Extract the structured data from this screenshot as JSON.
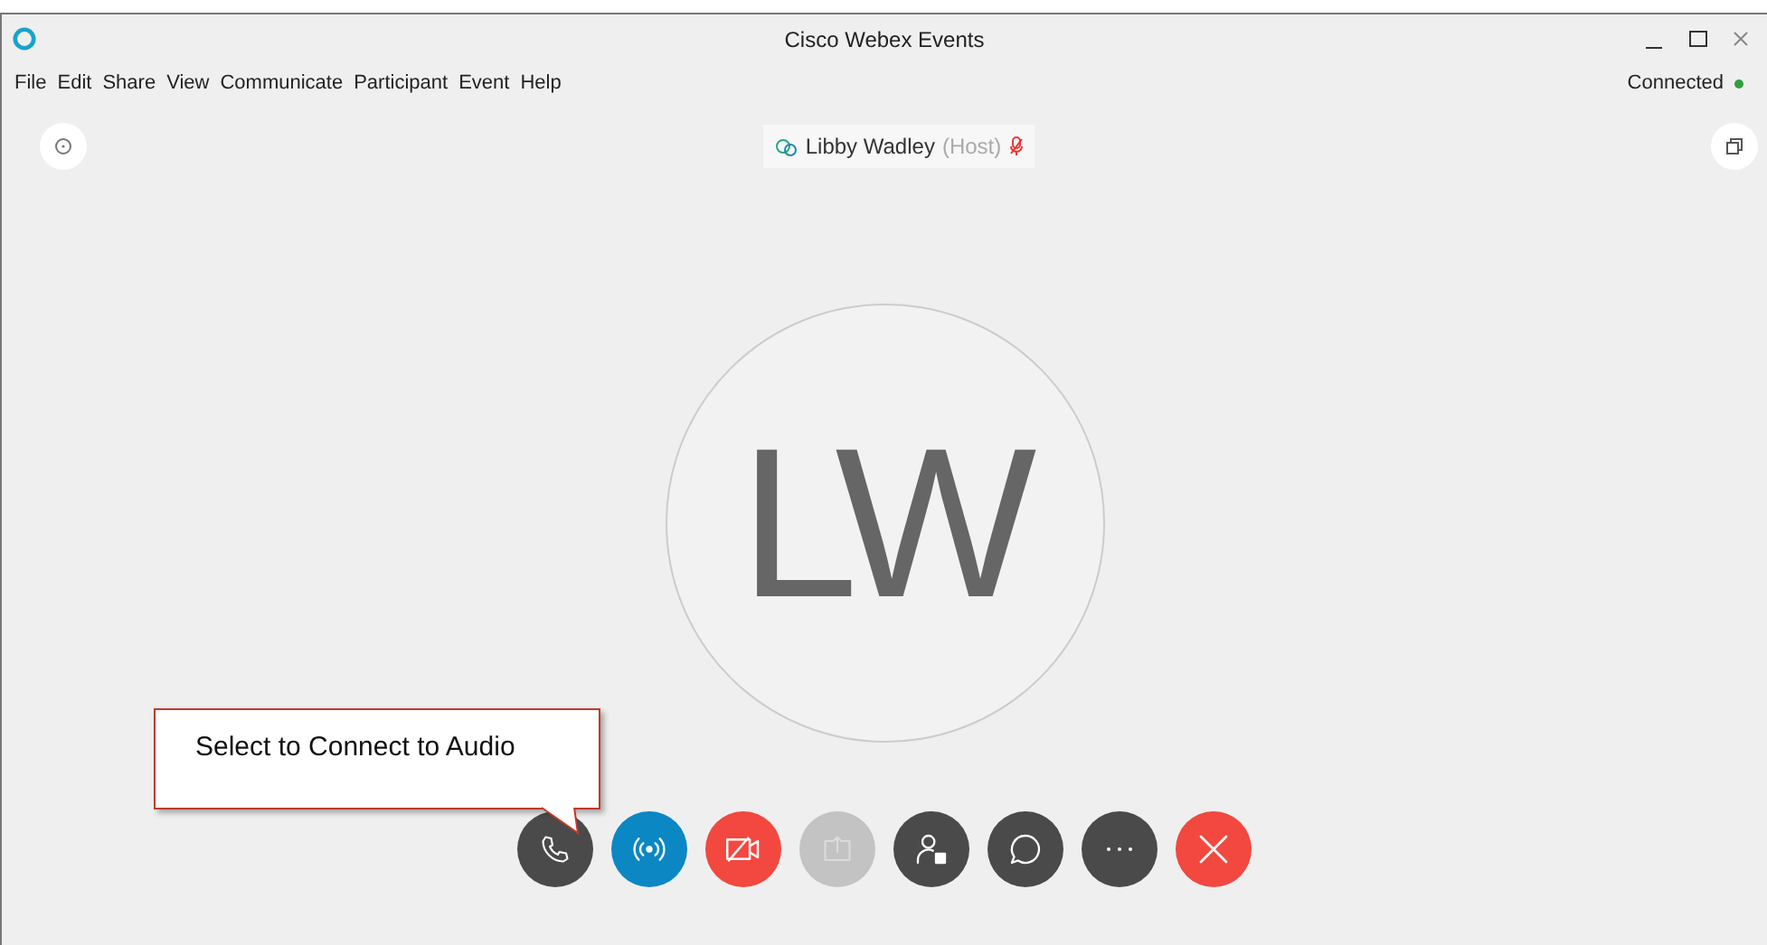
{
  "window": {
    "title": "Cisco Webex Events"
  },
  "menu": [
    "File",
    "Edit",
    "Share",
    "View",
    "Communicate",
    "Participant",
    "Event",
    "Help"
  ],
  "connection": {
    "label": "Connected",
    "on": true
  },
  "speaker": {
    "name": "Libby Wadley",
    "role": "(Host)",
    "muted": true
  },
  "avatar": {
    "initials": "LW"
  },
  "callout": {
    "text": "Select to Connect to Audio"
  },
  "controls": [
    {
      "kind": "phone",
      "disabled": false
    },
    {
      "kind": "broadcast",
      "disabled": false
    },
    {
      "kind": "video-off",
      "disabled": false
    },
    {
      "kind": "share",
      "disabled": true
    },
    {
      "kind": "participants",
      "disabled": false
    },
    {
      "kind": "chat",
      "disabled": false
    },
    {
      "kind": "more",
      "disabled": false
    },
    {
      "kind": "leave",
      "disabled": false
    }
  ]
}
